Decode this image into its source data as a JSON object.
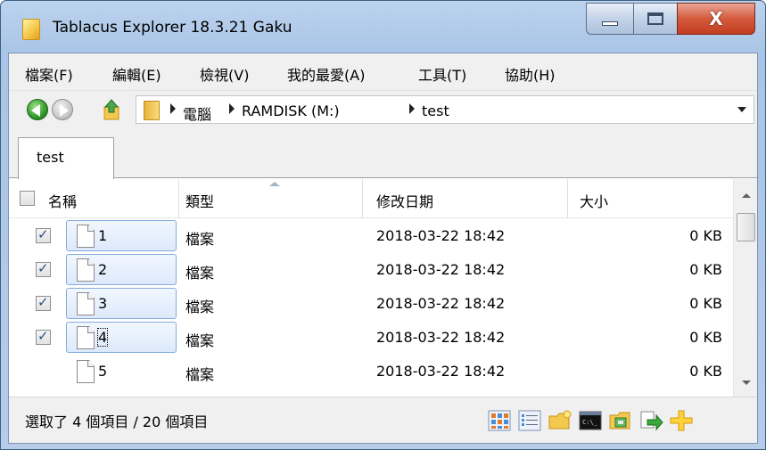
{
  "window": {
    "title": "Tablacus Explorer 18.3.21 Gaku",
    "icon": "folder-app-icon",
    "controls": {
      "minimize": "minimize",
      "maximize": "maximize",
      "close": "X"
    }
  },
  "menu": {
    "items": [
      {
        "label": "檔案(F)"
      },
      {
        "label": "編輯(E)"
      },
      {
        "label": "檢視(V)"
      },
      {
        "label": "我的最愛(A)"
      },
      {
        "label": "工具(T)"
      },
      {
        "label": "協助(H)"
      }
    ]
  },
  "address": {
    "crumbs": [
      "電腦",
      "RAMDISK (M:)",
      "test"
    ]
  },
  "tabs": [
    {
      "label": "test",
      "active": true
    }
  ],
  "list": {
    "columns": [
      "名稱",
      "類型",
      "修改日期",
      "大小"
    ],
    "sorted_column": "類型",
    "rows": [
      {
        "name": "1",
        "type": "檔案",
        "modified": "2018-03-22 18:42",
        "size": "0 KB",
        "checked": true
      },
      {
        "name": "2",
        "type": "檔案",
        "modified": "2018-03-22 18:42",
        "size": "0 KB",
        "checked": true
      },
      {
        "name": "3",
        "type": "檔案",
        "modified": "2018-03-22 18:42",
        "size": "0 KB",
        "checked": true
      },
      {
        "name": "4",
        "type": "檔案",
        "modified": "2018-03-22 18:42",
        "size": "0 KB",
        "checked": true,
        "focused": true
      },
      {
        "name": "5",
        "type": "檔案",
        "modified": "2018-03-22 18:42",
        "size": "0 KB",
        "checked": false
      }
    ]
  },
  "status": {
    "text": "選取了 4 個項目 / 20 個項目"
  },
  "toolbar_icons": [
    "large-icons-view-icon",
    "details-view-icon",
    "new-folder-icon",
    "command-prompt-icon",
    "control-panel-icon",
    "move-to-icon",
    "add-icon"
  ],
  "colors": {
    "selection_border": "#84acdd",
    "selection_fill": "#dce9fb",
    "close_button": "#c23d1f",
    "title_bar": "#b5cdea"
  }
}
